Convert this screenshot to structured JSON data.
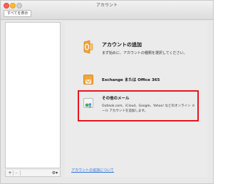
{
  "window": {
    "title": "アカウント"
  },
  "toolbar": {
    "show_all_label": "すべてを表示"
  },
  "sidebar": {
    "add_label": "+",
    "remove_label": "−",
    "gear_label": "⚙▾"
  },
  "main": {
    "hero_title": "アカウントの追加",
    "hero_subtitle": "まず始めに、アカウントの種類を選択してください。",
    "accounts": [
      {
        "title": "Exchange または Office 365",
        "description": ""
      },
      {
        "title": "その他のメール",
        "description": "Outlook.com、iCloud、Google、Yahoo! などのオンライン メール アカウントを追加します。"
      }
    ],
    "help_link": "アカウントの追加について"
  },
  "colors": {
    "highlight": "#e8141c",
    "link": "#2a6fd6",
    "outlook": "#f2a63b"
  }
}
